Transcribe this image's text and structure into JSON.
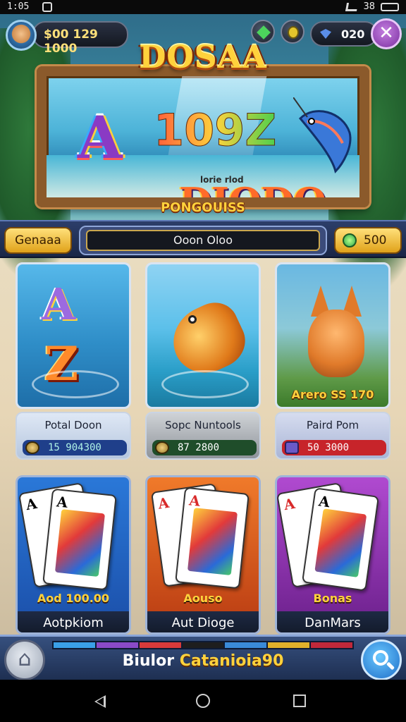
{
  "status_bar": {
    "time": "1:05",
    "right_text": "38"
  },
  "header": {
    "coins": "$00 129 1000",
    "gems": "020",
    "close_symbol": "✕"
  },
  "banner": {
    "title": "DOSAA",
    "big_number": "109Z",
    "small_label": "lorie rlod",
    "logo_word": "DIODO",
    "subtitle": "PONGOUISS"
  },
  "menu": {
    "genre_label": "Genaaa",
    "search_value": "Ooon Oloo",
    "cash_label": "500"
  },
  "games": [
    {
      "name": "Potal Doon",
      "amount": "15 904300",
      "caption": ""
    },
    {
      "name": "Sopc Nuntools",
      "amount": "87 2800",
      "caption": ""
    },
    {
      "name": "Paird Pom",
      "amount": "50 3000",
      "caption": "Arero SS 170"
    }
  ],
  "card_games": [
    {
      "tag": "Aod 100.00",
      "name": "Aotpkiom",
      "pip": "A"
    },
    {
      "tag": "Aouso",
      "name": "Aut Dioge",
      "pip": "A"
    },
    {
      "tag": "Bonas",
      "name": "DanMars",
      "pip": "A"
    }
  ],
  "bottom_bar": {
    "caption_prefix": "Biulor",
    "caption_accent": "Catanioia90",
    "progress_colors": [
      "#3aa0e8",
      "#8a4ac8",
      "#d83a3a",
      "#1e1e1e",
      "#3a8ad8",
      "#e0b02a",
      "#c0283a"
    ]
  },
  "icons": {
    "home": "home-icon",
    "search": "search-icon",
    "gem": "gem-icon",
    "coin": "coin-icon"
  }
}
